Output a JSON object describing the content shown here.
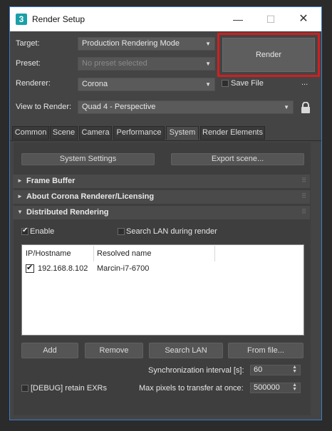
{
  "window": {
    "title": "Render Setup",
    "min": "—",
    "max": "☐",
    "close": "✕",
    "icon_letter": "3"
  },
  "top": {
    "target_label": "Target:",
    "target_value": "Production Rendering Mode",
    "preset_label": "Preset:",
    "preset_value": "No preset selected",
    "renderer_label": "Renderer:",
    "renderer_value": "Corona",
    "save_file_label": "Save File",
    "ellipsis": "...",
    "view_label": "View to Render:",
    "view_value": "Quad 4 - Perspective",
    "render_button": "Render"
  },
  "tabs": [
    "Common",
    "Scene",
    "Camera",
    "Performance",
    "System",
    "Render Elements"
  ],
  "active_tab": "System",
  "system": {
    "system_settings_btn": "System Settings",
    "export_scene_btn": "Export scene...",
    "rollouts": [
      "Frame Buffer",
      "About Corona Renderer/Licensing",
      "Distributed Rendering"
    ],
    "enable_label": "Enable",
    "search_lan_label": "Search LAN during render",
    "columns": [
      "IP/Hostname",
      "Resolved name"
    ],
    "rows": [
      {
        "ip": "192.168.8.102",
        "name": "Marcin-i7-6700",
        "checked": true
      }
    ],
    "buttons": [
      "Add",
      "Remove",
      "Search LAN",
      "From file..."
    ],
    "sync_label": "Synchronization interval [s]:",
    "sync_value": "60",
    "debug_label": "[DEBUG] retain EXRs",
    "max_pixels_label": "Max pixels to transfer at once:",
    "max_pixels_value": "500000"
  },
  "colors": {
    "highlight": "#d21f1f",
    "window_border": "#3d7cc9",
    "icon": "#19a0a8"
  }
}
